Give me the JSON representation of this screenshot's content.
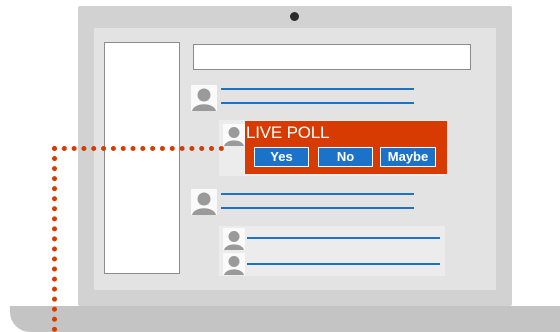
{
  "poll": {
    "title": "LIVE POLL",
    "options": [
      "Yes",
      "No",
      "Maybe"
    ]
  },
  "icons": {
    "avatar": "user-avatar-icon"
  },
  "colors": {
    "accent": "#d83b01",
    "link_blue": "#1a73c8",
    "screen": "#e3e3e3",
    "laptop_body": "#d2d2d2"
  }
}
